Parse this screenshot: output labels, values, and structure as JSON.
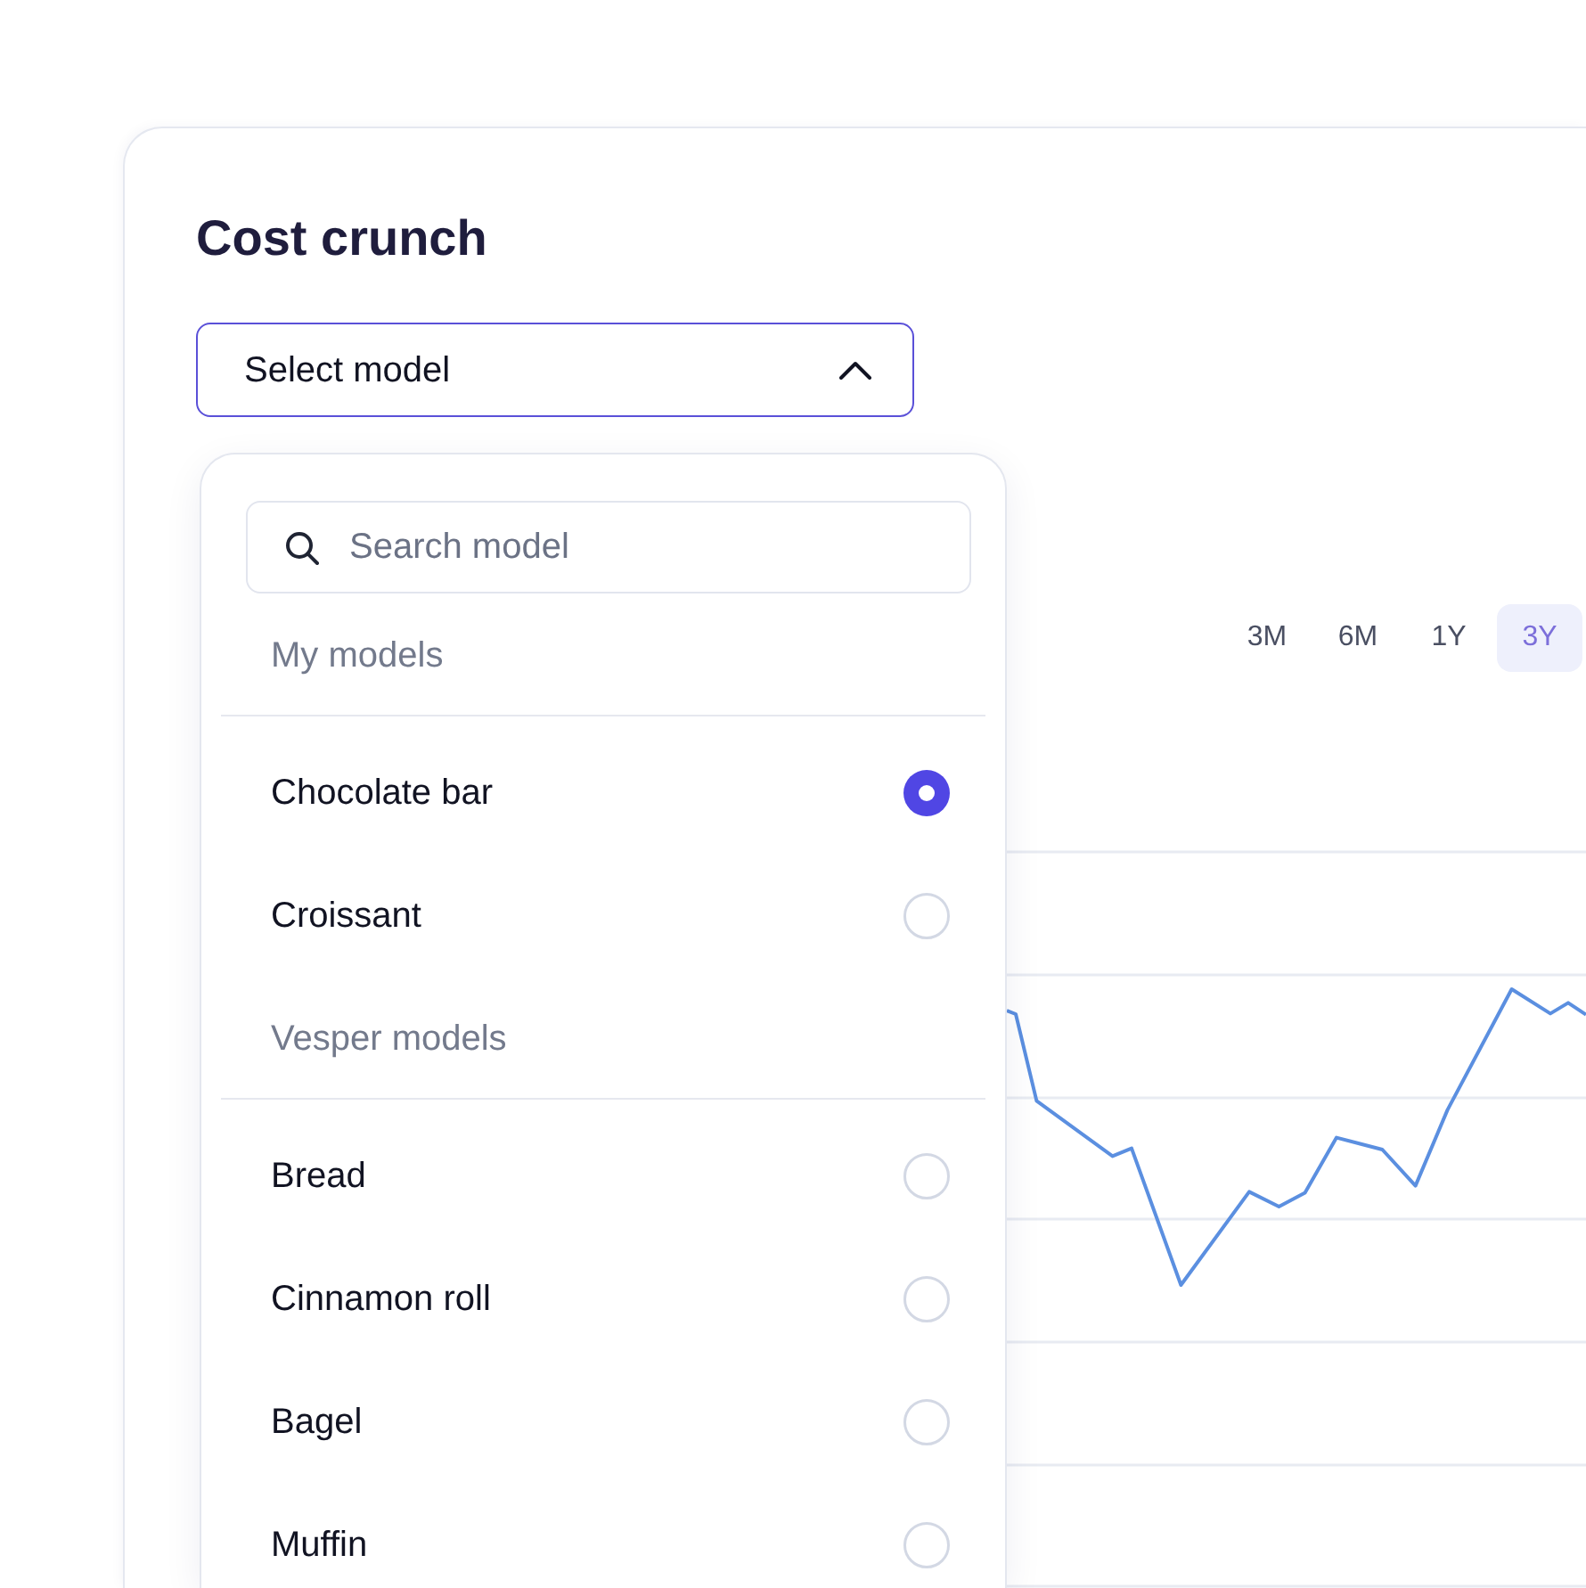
{
  "title": "Cost crunch",
  "model_select": {
    "label": "Select model",
    "expanded": true
  },
  "dropdown": {
    "search": {
      "placeholder": "Search model"
    },
    "groups": [
      {
        "heading": "My models",
        "items": [
          {
            "label": "Chocolate bar",
            "selected": true
          },
          {
            "label": "Croissant",
            "selected": false
          }
        ]
      },
      {
        "heading": "Vesper models",
        "items": [
          {
            "label": "Bread",
            "selected": false
          },
          {
            "label": "Cinnamon roll",
            "selected": false
          },
          {
            "label": "Bagel",
            "selected": false
          },
          {
            "label": "Muffin",
            "selected": false
          }
        ]
      }
    ]
  },
  "range_tabs": [
    {
      "label": "3M",
      "selected": false
    },
    {
      "label": "6M",
      "selected": false
    },
    {
      "label": "1Y",
      "selected": false
    },
    {
      "label": "3Y",
      "selected": true
    }
  ]
}
